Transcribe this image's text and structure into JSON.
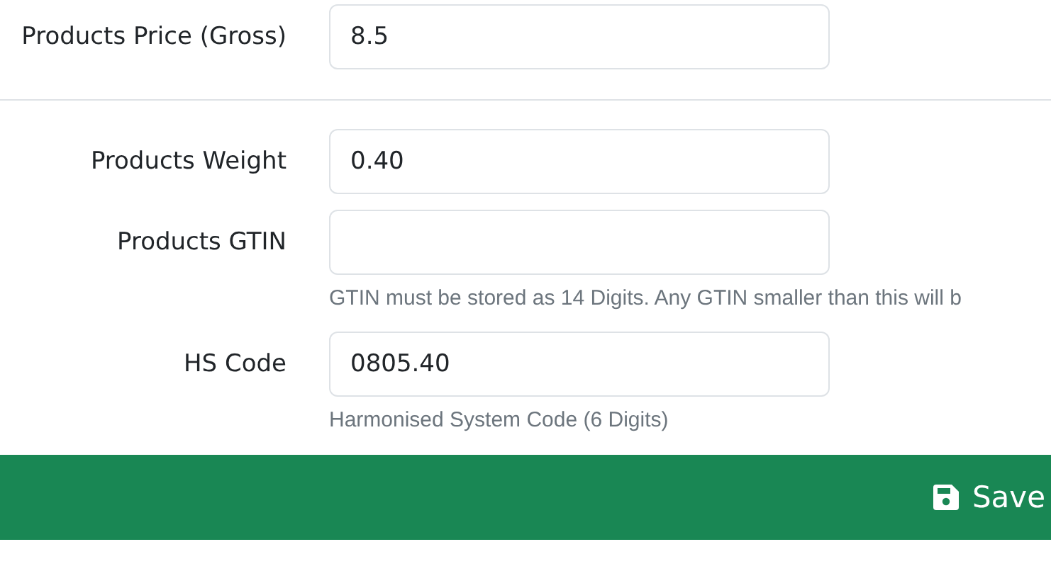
{
  "sections": [
    {
      "fields": [
        {
          "label": "Products Price (Gross)",
          "value": "8.5"
        }
      ]
    },
    {
      "fields": [
        {
          "label": "Products Weight",
          "value": "0.40"
        },
        {
          "label": "Products GTIN",
          "help": "GTIN must be stored as 14 Digits. Any GTIN smaller than this will b"
        },
        {
          "label": "HS Code",
          "value": "0805.40",
          "help": "Harmonised System Code (6 Digits)"
        }
      ]
    }
  ],
  "footer": {
    "save_label": "Save"
  }
}
